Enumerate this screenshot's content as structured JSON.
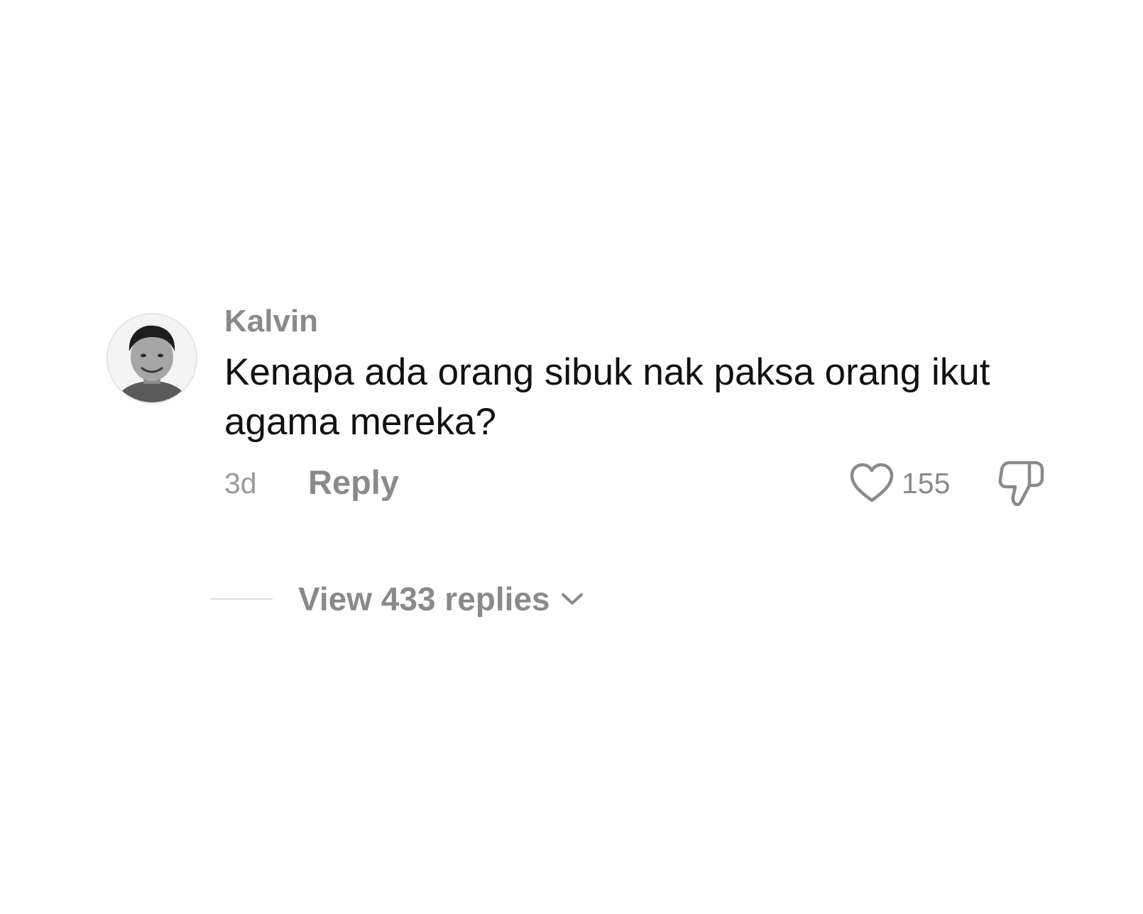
{
  "comment": {
    "username": "Kalvin",
    "text": "Kenapa ada orang sibuk nak paksa orang ikut agama mereka?",
    "timestamp": "3d",
    "reply_label": "Reply",
    "like_count": "155",
    "view_replies_label": "View 433 replies"
  },
  "icons": {
    "like": "heart-outline-icon",
    "dislike": "thumbs-down-outline-icon",
    "expand": "chevron-down-icon"
  },
  "colors": {
    "primary_text": "#111111",
    "secondary_text": "#8a8a8a",
    "background": "#ffffff"
  }
}
